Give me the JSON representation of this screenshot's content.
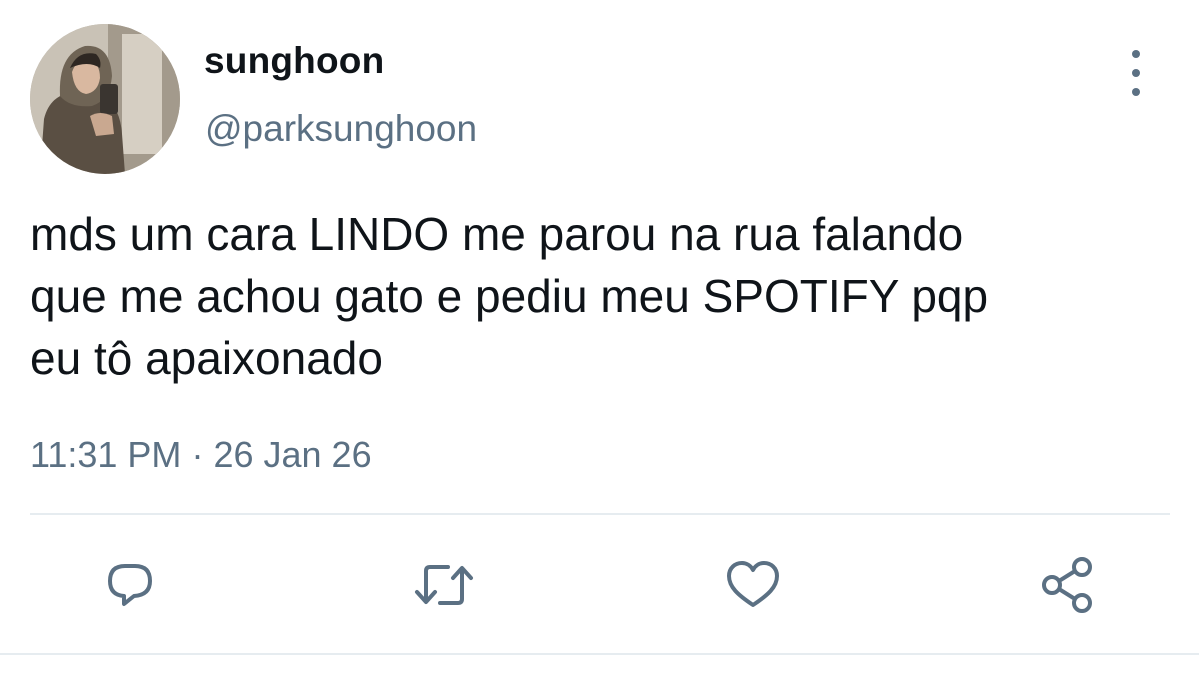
{
  "tweet": {
    "display_name": "sunghoon",
    "handle": "@parksunghoon",
    "text": "mds um cara LINDO me parou na rua falando\nque me achou gato e pediu meu SPOTIFY pqp\neu tô apaixonado",
    "time": "11:31 PM",
    "separator": "·",
    "date": "26 Jan 26"
  },
  "icons": {
    "more": "more-vertical-icon",
    "reply": "reply-icon",
    "retweet": "retweet-icon",
    "like": "heart-icon",
    "share": "share-icon"
  },
  "colors": {
    "text_primary": "#0f1419",
    "text_secondary": "#5b7083",
    "divider": "#e6ecf0",
    "background": "#ffffff"
  }
}
